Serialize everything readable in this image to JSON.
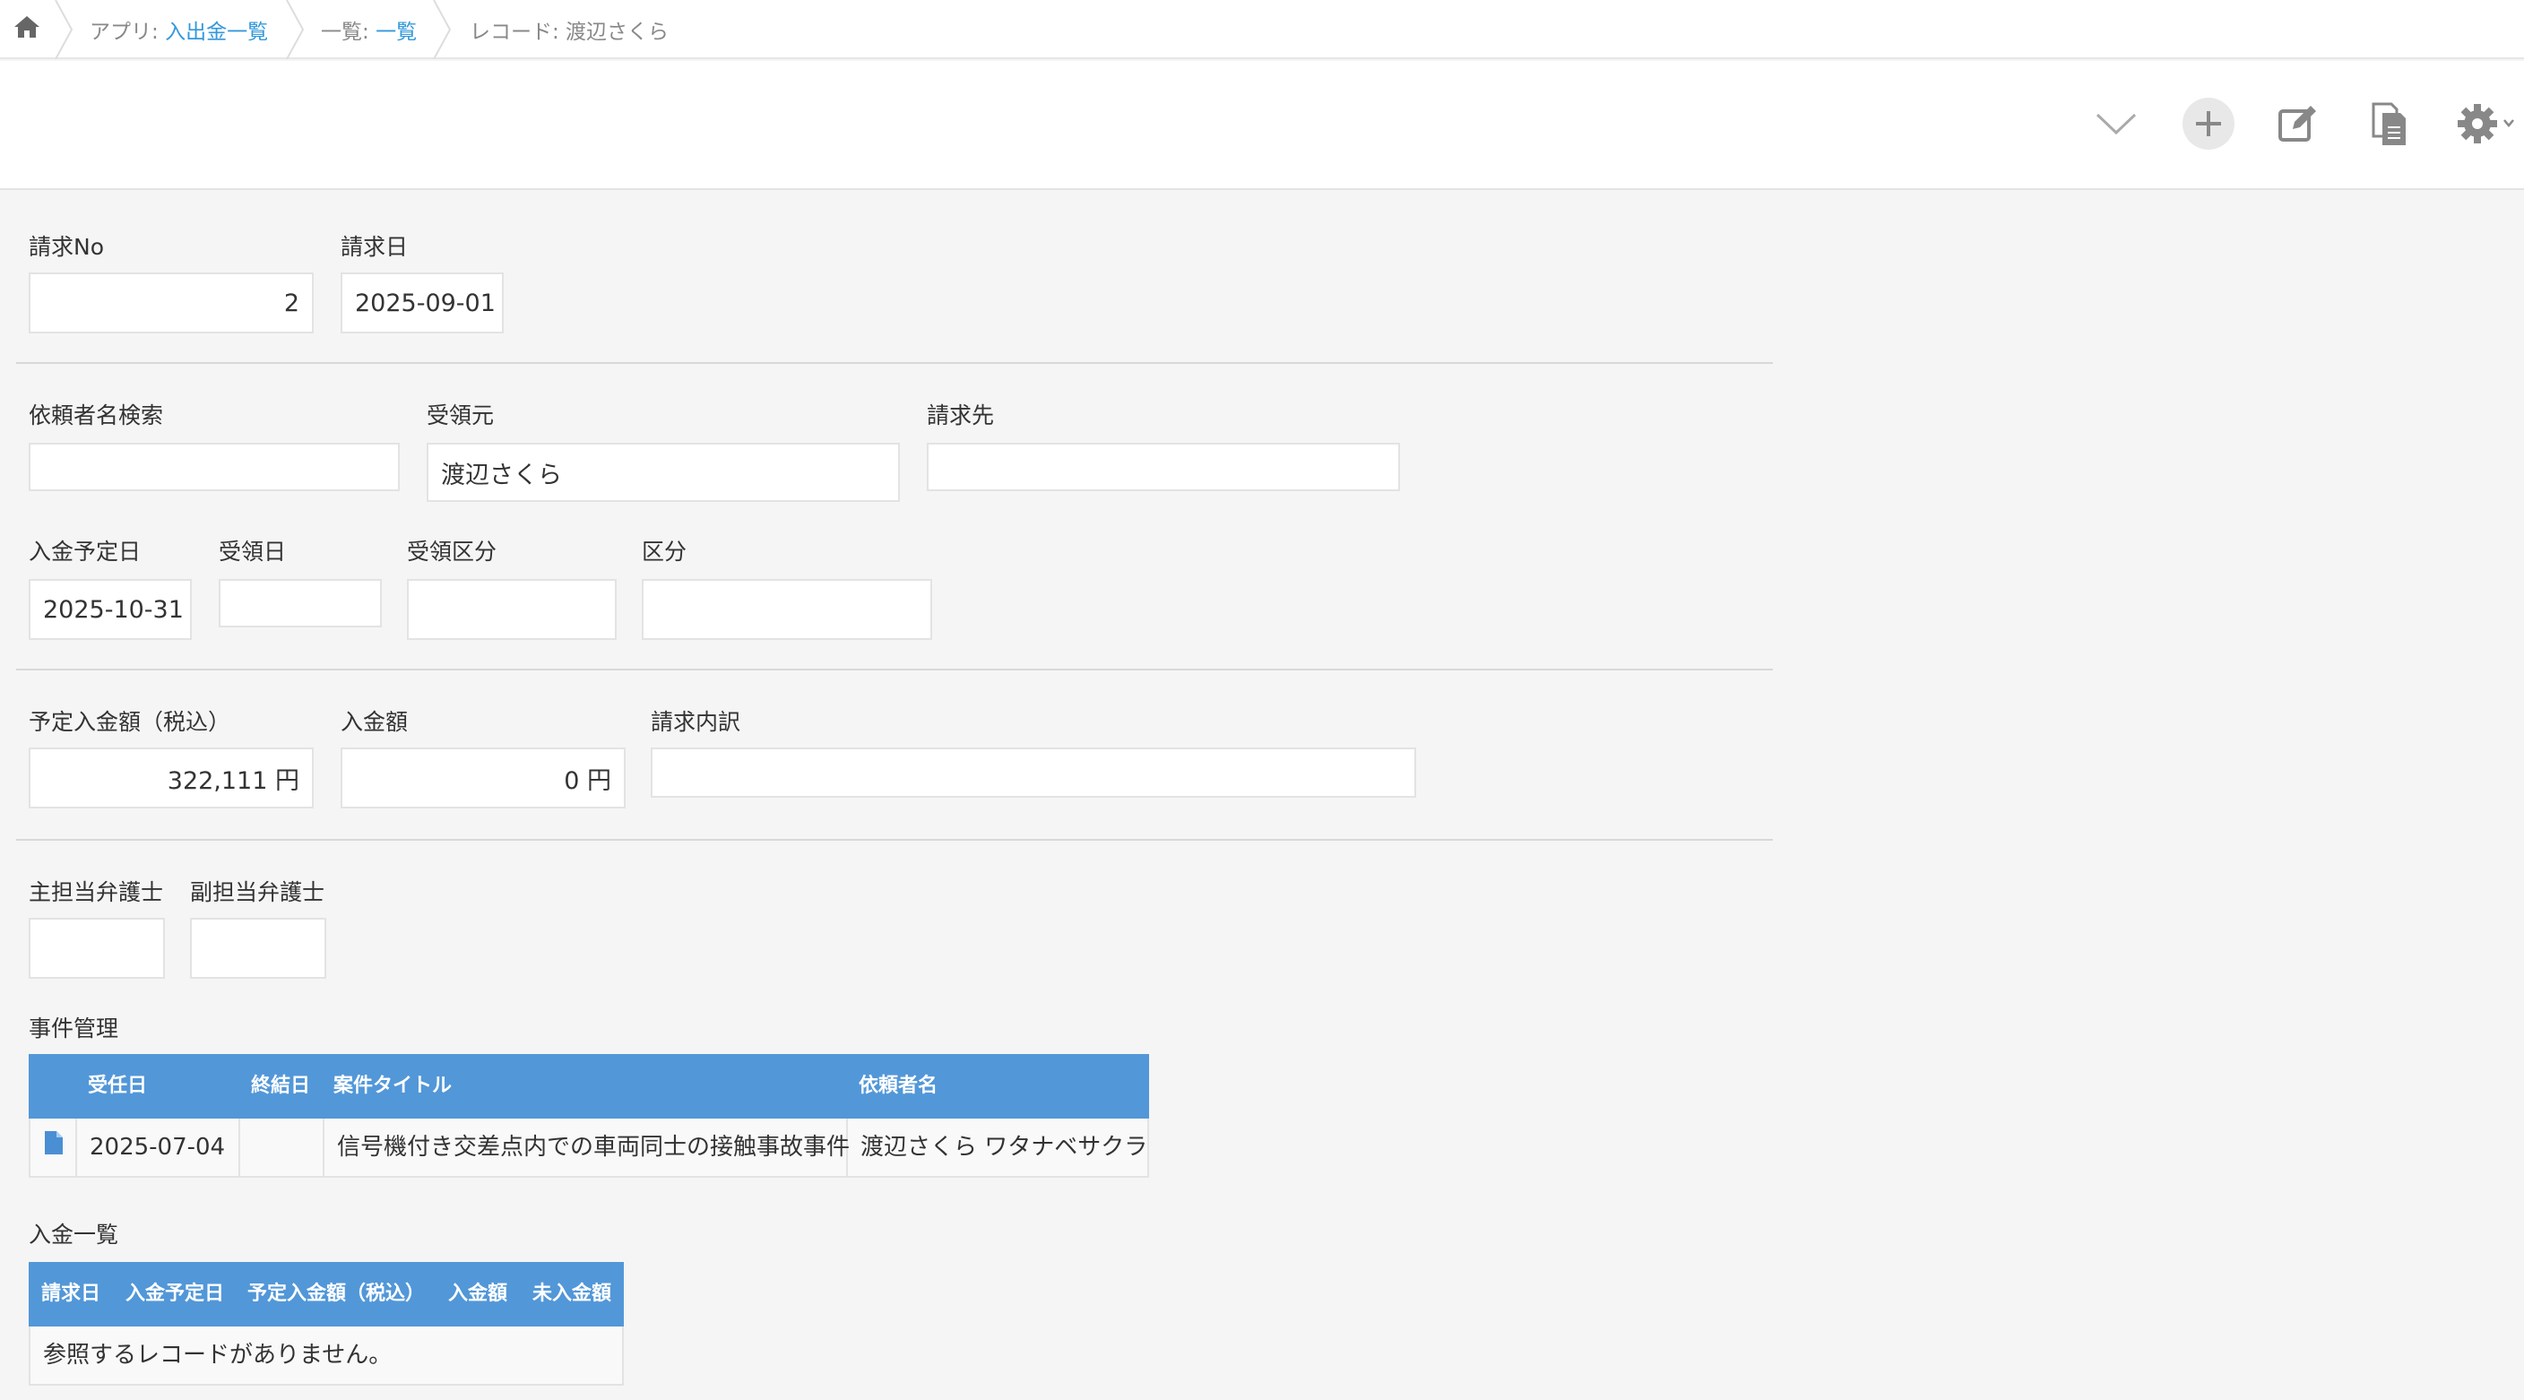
{
  "breadcrumb": {
    "app_prefix": "アプリ: ",
    "app_name": "入出金一覧",
    "view_prefix": "一覧: ",
    "view_name": "一覧",
    "record_label": "レコード: 渡辺さくら"
  },
  "toolbar": {
    "icons": [
      "chevron-down-icon",
      "plus-icon",
      "edit-icon",
      "copy-icon",
      "gear-icon"
    ]
  },
  "fields": {
    "invoice_no": {
      "label": "請求No",
      "value": "2"
    },
    "invoice_date": {
      "label": "請求日",
      "value": "2025-09-01"
    },
    "requester_search": {
      "label": "依頼者名検索",
      "value": ""
    },
    "received_from": {
      "label": "受領元",
      "value": "渡辺さくら"
    },
    "bill_to": {
      "label": "請求先",
      "value": ""
    },
    "expected_payment_date": {
      "label": "入金予定日",
      "value": "2025-10-31"
    },
    "received_date": {
      "label": "受領日",
      "value": ""
    },
    "receipt_category": {
      "label": "受領区分",
      "value": ""
    },
    "category": {
      "label": "区分",
      "value": ""
    },
    "expected_amount": {
      "label": "予定入金額（税込）",
      "value": "322,111 円"
    },
    "paid_amount": {
      "label": "入金額",
      "value": "0 円"
    },
    "invoice_breakdown": {
      "label": "請求内訳",
      "value": ""
    },
    "lead_lawyer": {
      "label": "主担当弁護士",
      "value": ""
    },
    "sub_lawyer": {
      "label": "副担当弁護士",
      "value": ""
    }
  },
  "case_table": {
    "title": "事件管理",
    "headers": [
      "受任日",
      "終結日",
      "案件タイトル",
      "依頼者名"
    ],
    "rows": [
      [
        "2025-07-04",
        "",
        "信号機付き交差点内での車両同士の接触事故事件",
        "渡辺さくら ワタナベサクラ"
      ]
    ]
  },
  "payment_table": {
    "title": "入金一覧",
    "headers": [
      "請求日",
      "入金予定日",
      "予定入金額（税込）",
      "入金額",
      "未入金額"
    ],
    "empty_message": "参照するレコードがありません。"
  },
  "colors": {
    "link": "#3498db",
    "table_header": "#5297d8",
    "icon_gray": "#888888"
  }
}
